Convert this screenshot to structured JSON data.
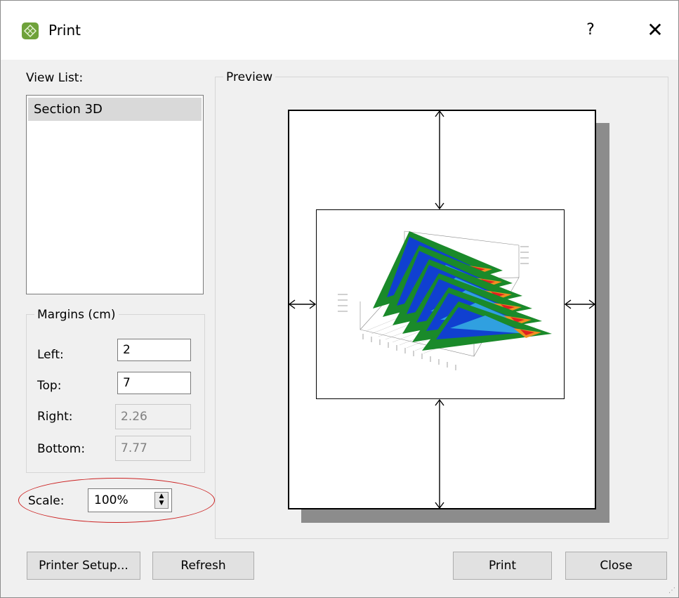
{
  "window": {
    "title": "Print",
    "help_label": "?",
    "close_label": "✕"
  },
  "view_list": {
    "label": "View List:",
    "items": [
      "Section 3D"
    ]
  },
  "preview": {
    "label": "Preview"
  },
  "margins": {
    "label": "Margins (cm)",
    "left_label": "Left:",
    "left_value": "2",
    "top_label": "Top:",
    "top_value": "7",
    "right_label": "Right:",
    "right_value": "2.26",
    "bottom_label": "Bottom:",
    "bottom_value": "7.77"
  },
  "scale": {
    "label": "Scale:",
    "value": "100%"
  },
  "buttons": {
    "printer_setup": "Printer Setup...",
    "refresh": "Refresh",
    "print": "Print",
    "close": "Close"
  },
  "colors": {
    "highlight_circle": "#cc2222",
    "list_selection": "#d9d9d9",
    "icon": "#6fa23b"
  }
}
